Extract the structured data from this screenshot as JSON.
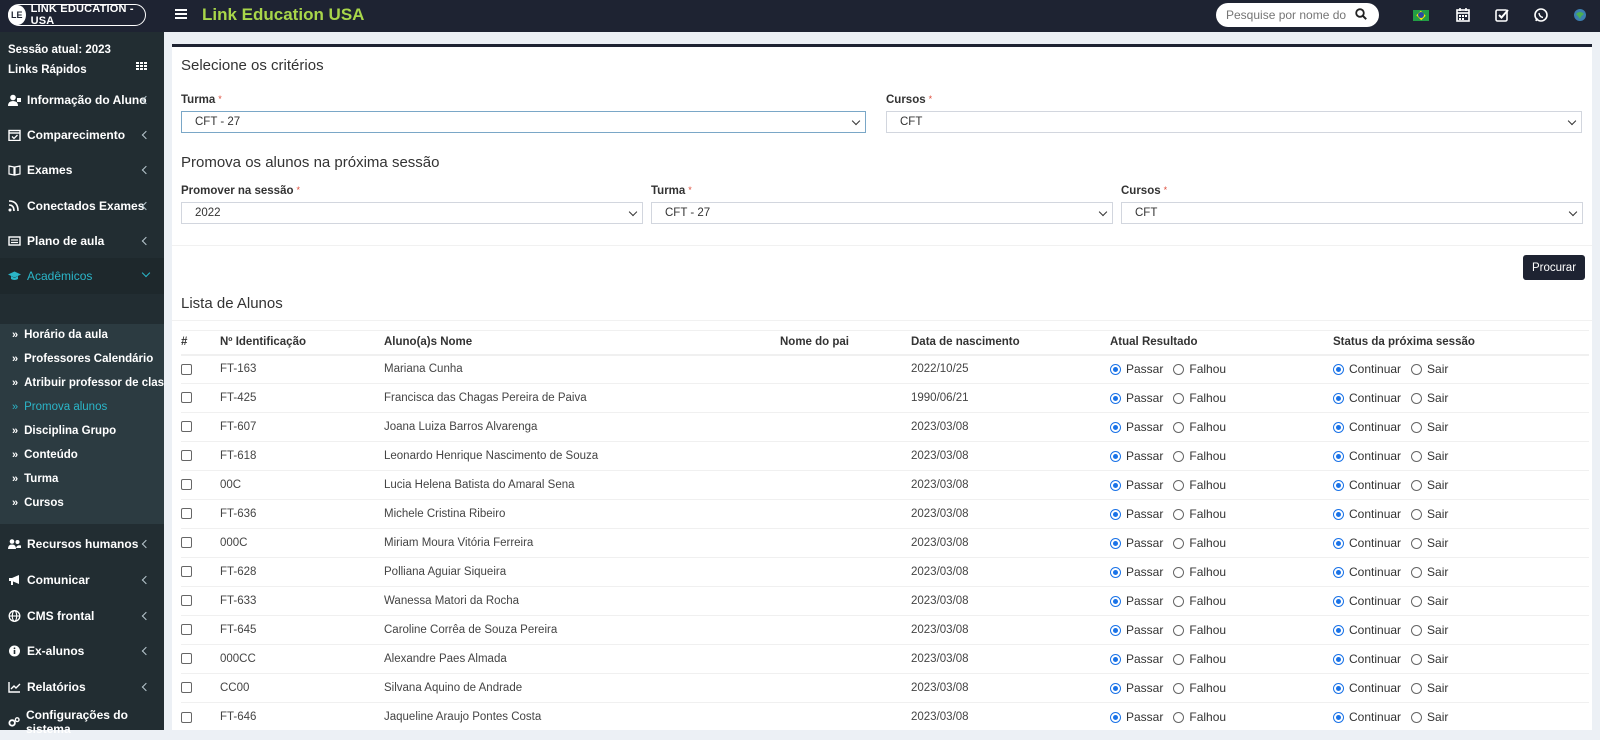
{
  "topbar": {
    "logo_text": "LINK EDUCATION - USA",
    "app_title": "Link Education USA",
    "search_placeholder": "Pesquise por nome do al"
  },
  "sidebar": {
    "session": "Sessão atual: 2023",
    "quick_links": "Links Rápidos",
    "items": [
      {
        "label": "Informação do Aluno",
        "icon": "user-card-icon"
      },
      {
        "label": "Comparecimento",
        "icon": "calendar-check-icon"
      },
      {
        "label": "Exames",
        "icon": "book-icon"
      },
      {
        "label": "Conectados Exames",
        "icon": "rss-icon"
      },
      {
        "label": "Plano de aula",
        "icon": "lesson-plan-icon"
      },
      {
        "label": "Acadêmicos",
        "icon": "graduation-cap-icon"
      },
      {
        "label": "Recursos humanos",
        "icon": "users-icon"
      },
      {
        "label": "Comunicar",
        "icon": "bullhorn-icon"
      },
      {
        "label": "CMS frontal",
        "icon": "globe-icon"
      },
      {
        "label": "Ex-alunos",
        "icon": "info-circle-icon"
      },
      {
        "label": "Relatórios",
        "icon": "line-chart-icon"
      },
      {
        "label": "Configurações do sistema",
        "icon": "cogs-icon"
      }
    ],
    "submenu": [
      "Horário da aula",
      "Professores Calendário",
      "Atribuir professor de classe",
      "Promova alunos",
      "Disciplina Grupo",
      "Conteúdo",
      "Turma",
      "Cursos"
    ]
  },
  "criteria": {
    "title": "Selecione os critérios",
    "turma_label": "Turma",
    "turma_value": "CFT - 27",
    "cursos_label": "Cursos",
    "cursos_value": "CFT"
  },
  "promote": {
    "title": "Promova os alunos na próxima sessão",
    "session_label": "Promover na sessão",
    "session_value": "2022",
    "turma_label": "Turma",
    "turma_value": "CFT - 27",
    "cursos_label": "Cursos",
    "cursos_value": "CFT",
    "button": "Procurar"
  },
  "students": {
    "title": "Lista de Alunos",
    "columns": [
      "#",
      "Nº Identificação",
      "Aluno(a)s Nome",
      "Nome do pai",
      "Data de nascimento",
      "Atual Resultado",
      "Status da próxima sessão"
    ],
    "result_options": [
      "Passar",
      "Falhou"
    ],
    "status_options": [
      "Continuar",
      "Sair"
    ],
    "rows": [
      {
        "id": "FT-163",
        "name": "Mariana Cunha",
        "father": "",
        "dob": "2022/10/25"
      },
      {
        "id": "FT-425",
        "name": "Francisca das Chagas Pereira de Paiva",
        "father": "",
        "dob": "1990/06/21"
      },
      {
        "id": "FT-607",
        "name": "Joana Luiza Barros Alvarenga",
        "father": "",
        "dob": "2023/03/08"
      },
      {
        "id": "FT-618",
        "name": "Leonardo Henrique Nascimento de Souza",
        "father": "",
        "dob": "2023/03/08"
      },
      {
        "id": "00C",
        "name": "Lucia Helena Batista do Amaral Sena",
        "father": "",
        "dob": "2023/03/08"
      },
      {
        "id": "FT-636",
        "name": "Michele Cristina Ribeiro",
        "father": "",
        "dob": "2023/03/08"
      },
      {
        "id": "000C",
        "name": "Miriam Moura Vitória Ferreira",
        "father": "",
        "dob": "2023/03/08"
      },
      {
        "id": "FT-628",
        "name": "Polliana Aguiar Siqueira",
        "father": "",
        "dob": "2023/03/08"
      },
      {
        "id": "FT-633",
        "name": "Wanessa Matori da Rocha",
        "father": "",
        "dob": "2023/03/08"
      },
      {
        "id": "FT-645",
        "name": "Caroline Corrêa de Souza Pereira",
        "father": "",
        "dob": "2023/03/08"
      },
      {
        "id": "000CC",
        "name": "Alexandre Paes Almada",
        "father": "",
        "dob": "2023/03/08"
      },
      {
        "id": "CC00",
        "name": "Silvana Aquino de Andrade",
        "father": "",
        "dob": "2023/03/08"
      },
      {
        "id": "FT-646",
        "name": "Jaqueline Araujo Pontes Costa",
        "father": "",
        "dob": "2023/03/08"
      }
    ]
  }
}
